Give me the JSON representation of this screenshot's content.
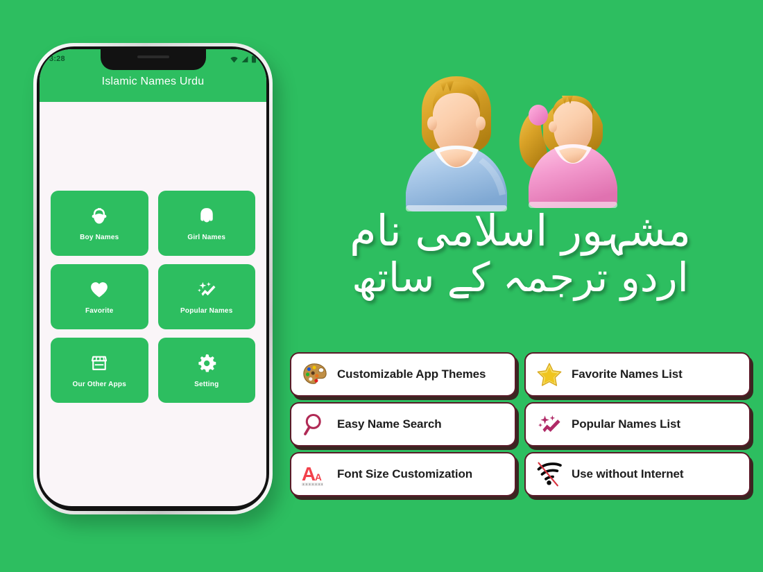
{
  "background_color": "#2dbe60",
  "phone": {
    "status_bar": {
      "time": "3:28",
      "icons": [
        "wifi-icon",
        "signal-icon",
        "battery-icon"
      ]
    },
    "app_bar": {
      "title": "Islamic Names Urdu"
    },
    "tiles": [
      {
        "label": "Boy Names",
        "icon": "boy-face-icon"
      },
      {
        "label": "Girl Names",
        "icon": "girl-face-icon"
      },
      {
        "label": "Favorite",
        "icon": "heart-icon"
      },
      {
        "label": "Popular Names",
        "icon": "sparkle-trend-icon"
      },
      {
        "label": "Our Other Apps",
        "icon": "storefront-icon"
      },
      {
        "label": "Setting",
        "icon": "gear-icon"
      }
    ],
    "tile_color": "#2dbe60",
    "screen_color": "#faf5f8"
  },
  "illustration": {
    "name": "two-user-avatars",
    "male_shirt_color": "#a9c8e8",
    "female_shirt_color": "#f49ccf",
    "hair_color": "#d9a227",
    "skin_color": "#fbceab"
  },
  "headline": {
    "line1": "مشہور اسلامی نام",
    "line2": "اردو ترجمہ کے ساتھ",
    "color": "#ffffff"
  },
  "features": {
    "border_color": "#5a1a28",
    "cards": [
      {
        "label": "Customizable App Themes",
        "icon": "paint-palette-icon"
      },
      {
        "label": "Favorite Names List",
        "icon": "star-icon"
      },
      {
        "label": "Easy Name Search",
        "icon": "magnifier-icon"
      },
      {
        "label": "Popular Names List",
        "icon": "sparkle-trend-icon"
      },
      {
        "label": "Font Size Customization",
        "icon": "font-size-icon"
      },
      {
        "label": "Use without Internet",
        "icon": "wifi-off-icon"
      }
    ]
  }
}
